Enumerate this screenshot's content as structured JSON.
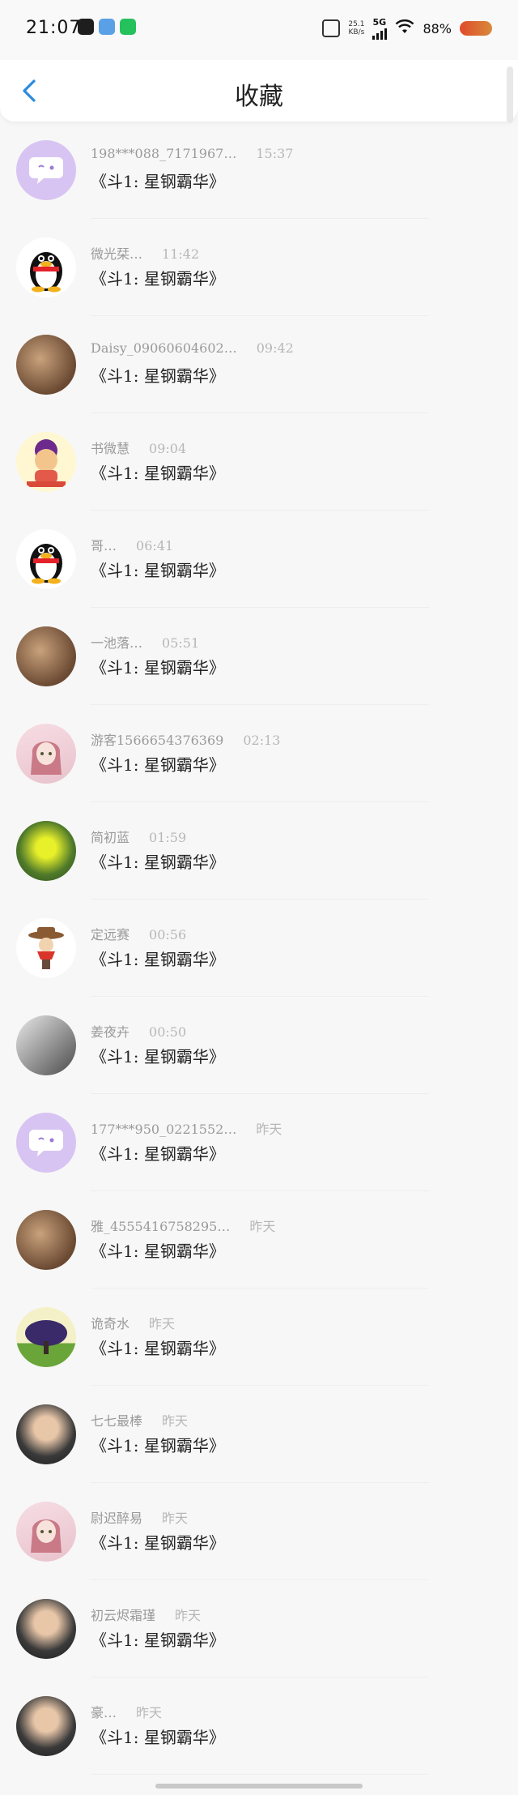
{
  "status_bar": {
    "time": "21:07",
    "net_speed_top": "25.1",
    "net_speed_bottom": "KB/s",
    "network": "5G",
    "battery": "88%"
  },
  "nav": {
    "title": "收藏"
  },
  "message_preview": "《斗1: 星钢霸华》",
  "rows": [
    {
      "name": "198***088_7171967…",
      "time": "15:37",
      "avatar": "bubble"
    },
    {
      "name": "微光栞…",
      "time": "11:42",
      "avatar": "penguin"
    },
    {
      "name": "Daisy_09060604602…",
      "time": "09:42",
      "avatar": "photo"
    },
    {
      "name": "书微慧",
      "time": "09:04",
      "avatar": "cartoon"
    },
    {
      "name": "哥…",
      "time": "06:41",
      "avatar": "penguin"
    },
    {
      "name": "一池落…",
      "time": "05:51",
      "avatar": "photo"
    },
    {
      "name": "游客1566654376369",
      "time": "02:13",
      "avatar": "anime"
    },
    {
      "name": "简初蓝",
      "time": "01:59",
      "avatar": "flower"
    },
    {
      "name": "定远赛",
      "time": "00:56",
      "avatar": "cowboy"
    },
    {
      "name": "姜夜卉",
      "time": "00:50",
      "avatar": "sketch"
    },
    {
      "name": "177***950_0221552…",
      "time": "昨天",
      "avatar": "bubble"
    },
    {
      "name": "雅_4555416758295…",
      "time": "昨天",
      "avatar": "photo"
    },
    {
      "name": "诡奇水",
      "time": "昨天",
      "avatar": "tree"
    },
    {
      "name": "七七最棒",
      "time": "昨天",
      "avatar": "portrait"
    },
    {
      "name": "尉迟醉易",
      "time": "昨天",
      "avatar": "anime"
    },
    {
      "name": "初云烬霜瑾",
      "time": "昨天",
      "avatar": "portrait"
    },
    {
      "name": "豪…",
      "time": "昨天",
      "avatar": "portrait"
    }
  ]
}
